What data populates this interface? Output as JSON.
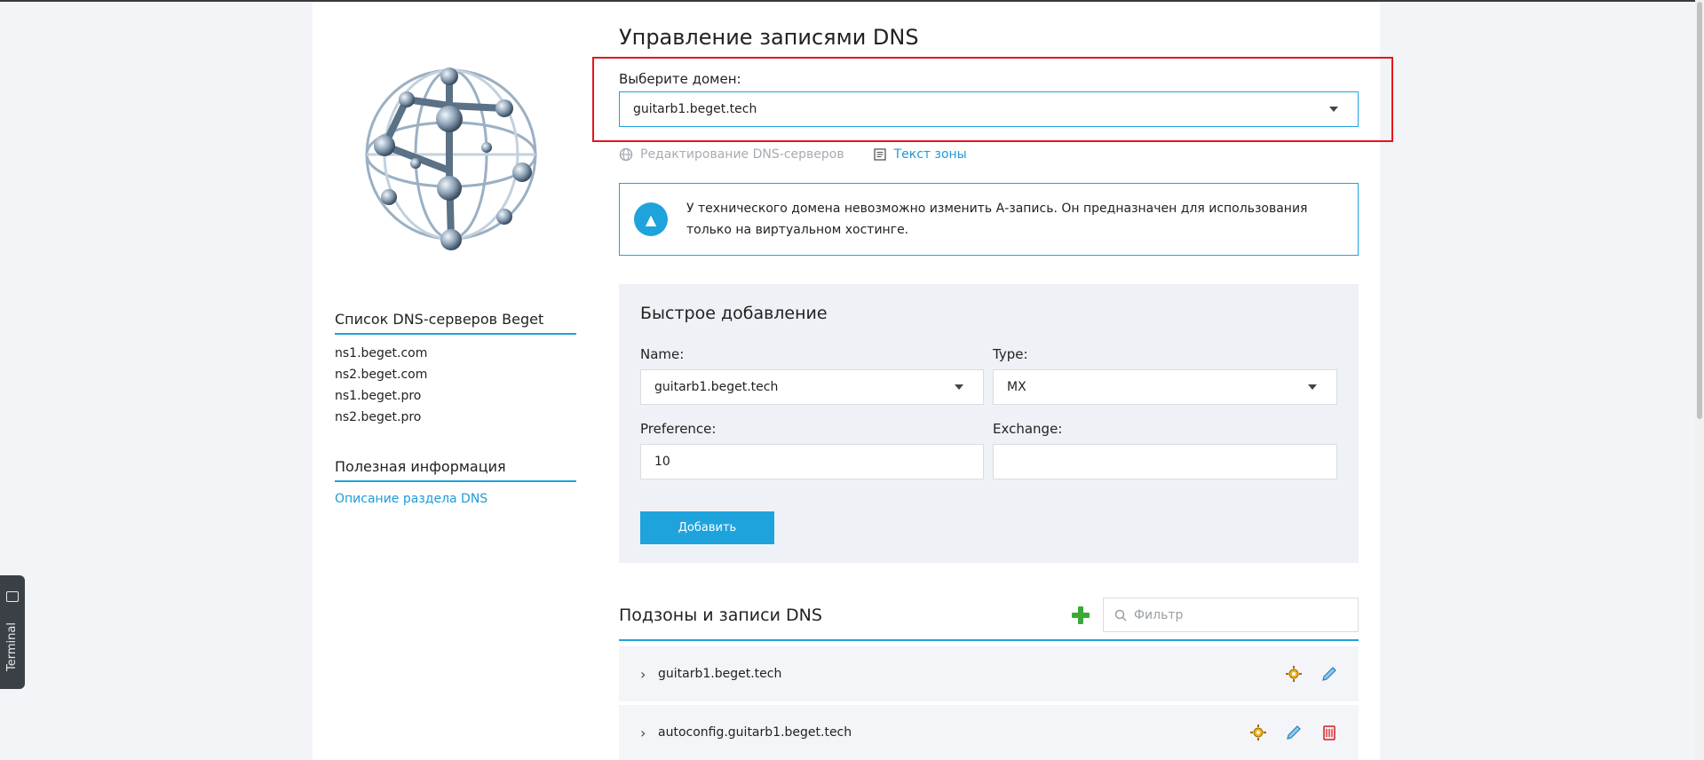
{
  "page_title": "Управление записями DNS",
  "domain_select": {
    "label": "Выберите домен:",
    "value": "guitarb1.beget.tech"
  },
  "links": {
    "edit_dns": "Редактирование DNS-серверов",
    "zone_text": "Текст зоны"
  },
  "notice": {
    "text": "У технического домена невозможно изменить А-запись. Он предназначен для использования только на виртуальном хостинге."
  },
  "sidebar": {
    "dns_heading": "Список DNS-серверов Beget",
    "servers": [
      "ns1.beget.com",
      "ns2.beget.com",
      "ns1.beget.pro",
      "ns2.beget.pro"
    ],
    "info_heading": "Полезная информация",
    "info_link": "Описание раздела DNS"
  },
  "quick_add": {
    "title": "Быстрое добавление",
    "name_label": "Name:",
    "name_value": "guitarb1.beget.tech",
    "type_label": "Type:",
    "type_value": "MX",
    "preference_label": "Preference:",
    "preference_value": "10",
    "exchange_label": "Exchange:",
    "exchange_value": "",
    "button": "Добавить"
  },
  "records": {
    "title": "Подзоны и записи DNS",
    "filter_placeholder": "Фильтр",
    "rows": [
      {
        "name": "guitarb1.beget.tech"
      },
      {
        "name": "autoconfig.guitarb1.beget.tech"
      }
    ]
  },
  "terminal": {
    "label": "Terminal"
  },
  "colors": {
    "accent": "#1fa3dc",
    "highlight": "#e3161d",
    "plus": "#3aaa35"
  }
}
